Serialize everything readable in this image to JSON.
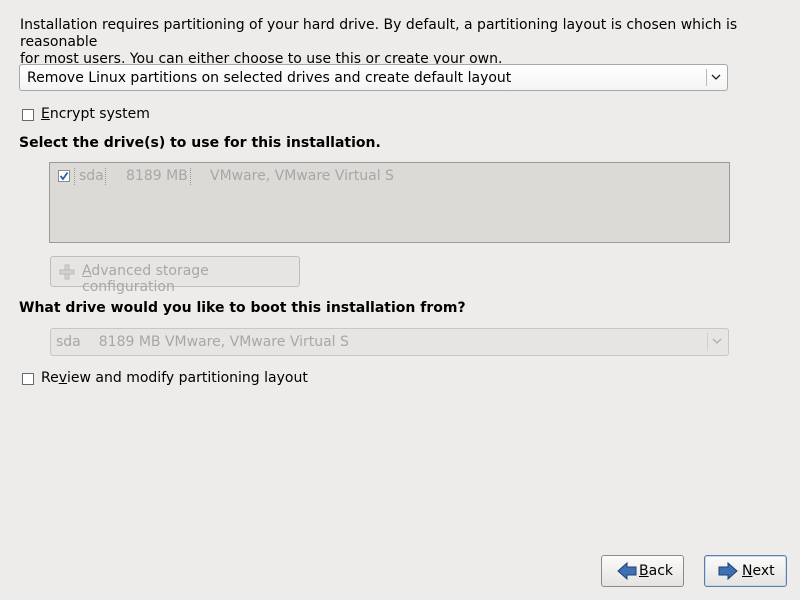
{
  "intro": {
    "line1": "Installation requires partitioning of your hard drive.  By default, a partitioning layout is chosen which is reasonable",
    "line2": "for most users.  You can either choose to use this or create your own."
  },
  "layout_select": {
    "value": "Remove Linux partitions on selected drives and create default layout"
  },
  "encrypt": {
    "mnemonic": "E",
    "label_rest": "ncrypt system",
    "checked": false
  },
  "drives_section": {
    "title": "Select the drive(s) to use for this installation.",
    "drives": [
      {
        "name": "sda",
        "size": "8189 MB",
        "model": "VMware, VMware Virtual S",
        "checked": true
      }
    ]
  },
  "advanced_button": {
    "mnemonic": "A",
    "label_rest": "dvanced storage configuration"
  },
  "boot_section": {
    "title": "What drive would you like to boot this installation from?",
    "selected_name": "sda",
    "selected_detail": "8189 MB VMware, VMware Virtual S"
  },
  "review": {
    "label_pre": "Re",
    "mnemonic": "v",
    "label_post": "iew and modify partitioning layout",
    "checked": false
  },
  "buttons": {
    "back_mnemonic": "B",
    "back_rest": "ack",
    "next_mnemonic": "N",
    "next_rest": "ext"
  },
  "colors": {
    "background": "#edeceb",
    "disabled_text": "#a9a7a4",
    "arrow_blue": "#3f6fb5"
  }
}
